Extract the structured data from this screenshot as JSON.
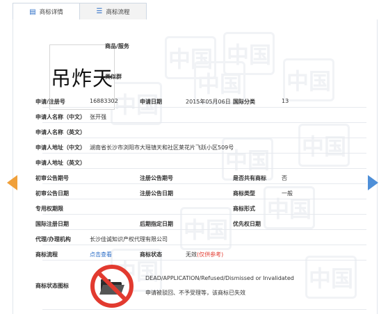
{
  "tabs": [
    {
      "label": "商标详情",
      "icon": "document-list-icon"
    },
    {
      "label": "商标流程",
      "icon": "flow-list-icon"
    }
  ],
  "logo": {
    "text": "吊炸天"
  },
  "watermark": "中国",
  "header_fields": {
    "goods_services_label": "商品/服务",
    "similar_group_label": "类似群"
  },
  "fields": {
    "app_no_label": "申请/注册号",
    "app_no": "16883302",
    "app_date_label": "申请日期",
    "app_date": "2015年05月06日",
    "intl_class_label": "国际分类",
    "intl_class": "13",
    "applicant_cn_label": "申请人名称（中文）",
    "applicant_cn": "张开强",
    "applicant_en_label": "申请人名称（英文）",
    "address_cn_label": "申请人地址（中文）",
    "address_cn": "湖南省长沙市浏阳市大瑶镇天和社区莱花片飞跃小区509号",
    "address_en_label": "申请人地址（英文）",
    "prelim_pub_no_label": "初审公告期号",
    "reg_pub_no_label": "注册公告期号",
    "shared_label": "是否共有商标",
    "shared": "否",
    "prelim_pub_date_label": "初审公告日期",
    "reg_pub_date_label": "注册公告日期",
    "mark_type_label": "商标类型",
    "mark_type": "一般",
    "exclusive_period_label": "专用权期限",
    "mark_form_label": "商标形式",
    "intl_reg_date_label": "国际注册日期",
    "later_designation_label": "后期指定日期",
    "priority_date_label": "优先权日期",
    "agent_label": "代理/办理机构",
    "agent": "长沙佳诚知识产权代理有限公司",
    "flow_label": "商标流程",
    "flow_link": "点击查看",
    "status_label": "商标状态",
    "status_value": "无效",
    "status_note": "(仅供参考)",
    "status_icon_label": "商标状态图标",
    "status_en": "DEAD/APPLICATION/Refused/Dismissed or Invalidated",
    "status_cn": "申请被驳回、不予受理等，该商标已失效"
  },
  "colors": {
    "accent": "#2a6cc6",
    "warning": "#e23a2f",
    "left_arrow": "#f0a03a",
    "right_arrow": "#4e8fd8"
  }
}
